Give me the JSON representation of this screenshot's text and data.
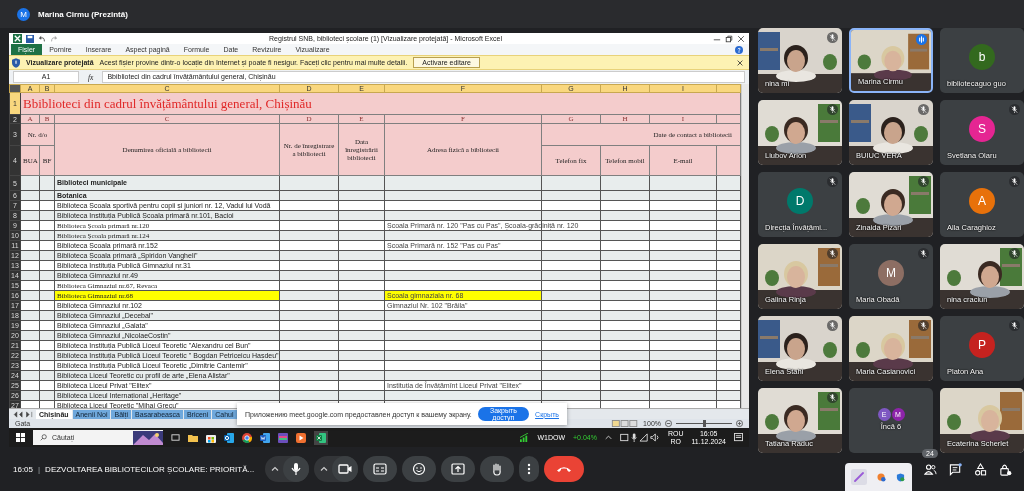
{
  "presenter_bar": {
    "avatar": "M",
    "label": "Marina Cirmu (Prezintă)"
  },
  "excel": {
    "title": "Registrul SNB, biblioteci școlare (1)  [Vizualizare protejată]  -  Microsoft Excel",
    "ribbon_tabs": [
      {
        "label": "Fișier",
        "kind": "file"
      },
      {
        "label": "Pornire",
        "kind": "tab"
      },
      {
        "label": "Inserare",
        "kind": "tab"
      },
      {
        "label": "Aspect pagină",
        "kind": "tab"
      },
      {
        "label": "Formule",
        "kind": "tab"
      },
      {
        "label": "Date",
        "kind": "tab"
      },
      {
        "label": "Revizuire",
        "kind": "tab"
      },
      {
        "label": "Vizualizare",
        "kind": "tab"
      }
    ],
    "protected_view": {
      "title": "Vizualizare protejată",
      "message": "Acest fișier provine dintr-o locație din Internet și poate fi nesigur. Faceți clic pentru mai multe detalii.",
      "button": "Activare editare"
    },
    "name_box": "A1",
    "function_label": "fx",
    "formula": "Bbiblioteci din cadrul învățământului general, Chișinău",
    "columns": [
      "A",
      "B",
      "C",
      "D",
      "E",
      "F",
      "G",
      "H",
      "I"
    ],
    "sheet": {
      "title": "Bbiblioteci din cadrul învățământului general, Chișinău",
      "header_row_numbers": [
        "1",
        "2",
        "3",
        "4"
      ],
      "letter_row": [
        "A",
        "B",
        "C",
        "D",
        "E",
        "F",
        "G",
        "H",
        "I"
      ],
      "headers": {
        "nr": "Nr. d/o",
        "bua": "BUA",
        "bf": "BF",
        "name": "Denumirea oficială a bibliotecii",
        "reg_no": "Nr. de înregistrare a bibliotecii",
        "reg_date": "Data înregistrării bibliotecii",
        "address": "Adresa  fizică  a bibliotecii",
        "contact": "Date de contact a bibliotecii",
        "phone": "Telefon fix",
        "mobile": "Telefon mobil",
        "email": "E-mail"
      },
      "rows": [
        {
          "number": "5",
          "name": "Biblioteci municipale",
          "kind": "section",
          "highlighted": false
        },
        {
          "number": "6",
          "name": "Botanica",
          "kind": "section",
          "highlighted": false
        },
        {
          "number": "7",
          "name": "Biblioteca Școala sportivă pentru copii și juniori nr. 12, Vadul lui Vodă",
          "kind": "entry",
          "highlighted": false
        },
        {
          "number": "8",
          "name": "Biblioteca Instituția Publică Școala primară nr.101, Bacioi",
          "kind": "entry",
          "highlighted": false
        },
        {
          "number": "9",
          "name": "Biblioteca Școala primară  nr.120",
          "kind": "serif",
          "highlighted": false,
          "address": "Școala Primară nr. 120 \"Pas cu Pas\", Școala-grădiniță nr. 120"
        },
        {
          "number": "10",
          "name": "Biblioteca Școala primară  nr.124",
          "kind": "serif",
          "highlighted": false
        },
        {
          "number": "11",
          "name": "Biblioteca Școala primară  nr.152",
          "kind": "entry",
          "highlighted": false,
          "address": "Școala Primară nr. 152 \"Pas cu Pas\""
        },
        {
          "number": "12",
          "name": "Biblioteca Școala primară „Spiridon Vangheli\"",
          "kind": "entry",
          "highlighted": false
        },
        {
          "number": "13",
          "name": "Biblioteca Instituția Publică Gimnaziul nr.31",
          "kind": "entry",
          "highlighted": false
        },
        {
          "number": "14",
          "name": "Biblioteca Gimnaziul nr.49",
          "kind": "entry",
          "highlighted": false
        },
        {
          "number": "15",
          "name": "Biblioteca Gimnaziul nr.67, Revaca",
          "kind": "serif",
          "highlighted": false
        },
        {
          "number": "16",
          "name": "Biblioteca Gimnaziul nr.68",
          "kind": "serif",
          "highlighted": true,
          "address": "Scoala gimnaziala nr. 68"
        },
        {
          "number": "17",
          "name": "Biblioteca Gimnaziul nr.102",
          "kind": "entry",
          "highlighted": false,
          "address": "Gimnaziul Nr. 102 \"Brăila\""
        },
        {
          "number": "18",
          "name": "Biblioteca Gimnaziul „Decebal\"",
          "kind": "entry",
          "highlighted": false
        },
        {
          "number": "19",
          "name": "Biblioteca Gimnaziul „Galata\"",
          "kind": "entry",
          "highlighted": false
        },
        {
          "number": "20",
          "name": "Biblioteca Gimnaziul „NicolaeCostin\"",
          "kind": "entry",
          "highlighted": false
        },
        {
          "number": "21",
          "name": "Biblioteca Instituția Publică Liceul Teoretic \"Alexandru cel Bun\"",
          "kind": "entry",
          "highlighted": false
        },
        {
          "number": "22",
          "name": "Biblioteca Instituția Publică Liceul Teoretic \" Bogdan Petriceicu Hașdeu\"",
          "kind": "entry",
          "highlighted": false
        },
        {
          "number": "23",
          "name": "Biblioteca Instituția Publică Liceul Teoretic „Dimitrie Cantemir\"",
          "kind": "entry",
          "highlighted": false
        },
        {
          "number": "24",
          "name": "Biblioteca Liceul Teoretic cu profil de arte „Elena Alistar\"",
          "kind": "entry",
          "highlighted": false
        },
        {
          "number": "25",
          "name": "Biblioteca  Liceul Privat \"Elitex\"",
          "kind": "entry",
          "highlighted": false,
          "address": "Instituția de Învățămînt Liceul Privat \"Elitex\""
        },
        {
          "number": "26",
          "name": "Biblioteca Liceul Internațional „Heritage\"",
          "kind": "entry",
          "highlighted": false
        },
        {
          "number": "27",
          "name": "Biblioteca Liceul Teoretic \"Mihai Grecu\"",
          "kind": "entry",
          "highlighted": false
        }
      ]
    },
    "sheet_tabs": [
      {
        "label": "Chișinău",
        "selected": true
      },
      {
        "label": "Anenii Noi",
        "selected": false
      },
      {
        "label": "Bălți",
        "selected": false
      },
      {
        "label": "Basarabeasca",
        "selected": false
      },
      {
        "label": "Briceni",
        "selected": false
      },
      {
        "label": "Cahul",
        "selected": false
      }
    ],
    "status": "Gata",
    "zoom": "100%",
    "zoom_slider": {
      "level": 0.5
    }
  },
  "share_notice": {
    "message": "Приложению meet.google.com предоставлен доступ к вашему экрану.",
    "stop_button": "Закрыть доступ",
    "hide_link": "Скрыть"
  },
  "taskbar": {
    "search_placeholder": "Căutați",
    "stock_symbol": "W1DOW",
    "stock_change": "+0.04%",
    "language": "ROU",
    "layout": "RO",
    "time": "16:05",
    "date": "11.12.2024"
  },
  "tiles": [
    {
      "kind": "video",
      "name": "nina mi",
      "muted": true,
      "speaking": false
    },
    {
      "kind": "video",
      "name": "Marina Cirmu",
      "muted": false,
      "speaking": true
    },
    {
      "kind": "avatar",
      "name": "bibliotecaguo guo",
      "initial": "b",
      "color": "#33691e",
      "muted": false,
      "speaking": false
    },
    {
      "kind": "video",
      "name": "Liubov Arion",
      "muted": true,
      "speaking": false
    },
    {
      "kind": "video",
      "name": "BUIUC VERA",
      "muted": true,
      "speaking": false
    },
    {
      "kind": "avatar",
      "name": "Svetlana Olaru",
      "initial": "S",
      "color": "#e52592",
      "muted": true,
      "speaking": false
    },
    {
      "kind": "avatar",
      "name": "Direcția Învățămi...",
      "initial": "D",
      "color": "#00796b",
      "muted": true,
      "speaking": false
    },
    {
      "kind": "video",
      "name": "Zinaida Pizari",
      "muted": true,
      "speaking": false
    },
    {
      "kind": "avatar",
      "name": "Alla Caraghioz",
      "initial": "A",
      "color": "#e8710a",
      "muted": true,
      "speaking": false
    },
    {
      "kind": "video",
      "name": "Galina Rinja",
      "muted": true,
      "speaking": false
    },
    {
      "kind": "avatar",
      "name": "Maria Obadă",
      "initial": "M",
      "color": "#8d6e63",
      "muted": true,
      "speaking": false
    },
    {
      "kind": "video",
      "name": "nina craciun",
      "muted": true,
      "speaking": false
    },
    {
      "kind": "video",
      "name": "Elena Stahi",
      "muted": true,
      "speaking": false
    },
    {
      "kind": "video",
      "name": "Maria Casianovici",
      "muted": true,
      "speaking": false
    },
    {
      "kind": "avatar",
      "name": "Platon Ana",
      "initial": "P",
      "color": "#c5221f",
      "muted": true,
      "speaking": false
    },
    {
      "kind": "video",
      "name": "Tatiana Raduc",
      "muted": true,
      "speaking": false
    },
    {
      "kind": "more",
      "name": "Încă 6",
      "muted": false,
      "speaking": false,
      "avatars": [
        {
          "initial": "E",
          "color": "#7e57c2"
        },
        {
          "initial": "M",
          "color": "#8e24aa"
        }
      ]
    },
    {
      "kind": "video",
      "name": "Ecaterina Scherlet",
      "muted": false,
      "speaking": false
    }
  ],
  "meeting_bar": {
    "time": "16:05",
    "separator": "|",
    "title": "DEZVOLTAREA BIBLIOTECILOR ȘCOLARE: PRIORITĂ...",
    "participants_count": "24"
  }
}
